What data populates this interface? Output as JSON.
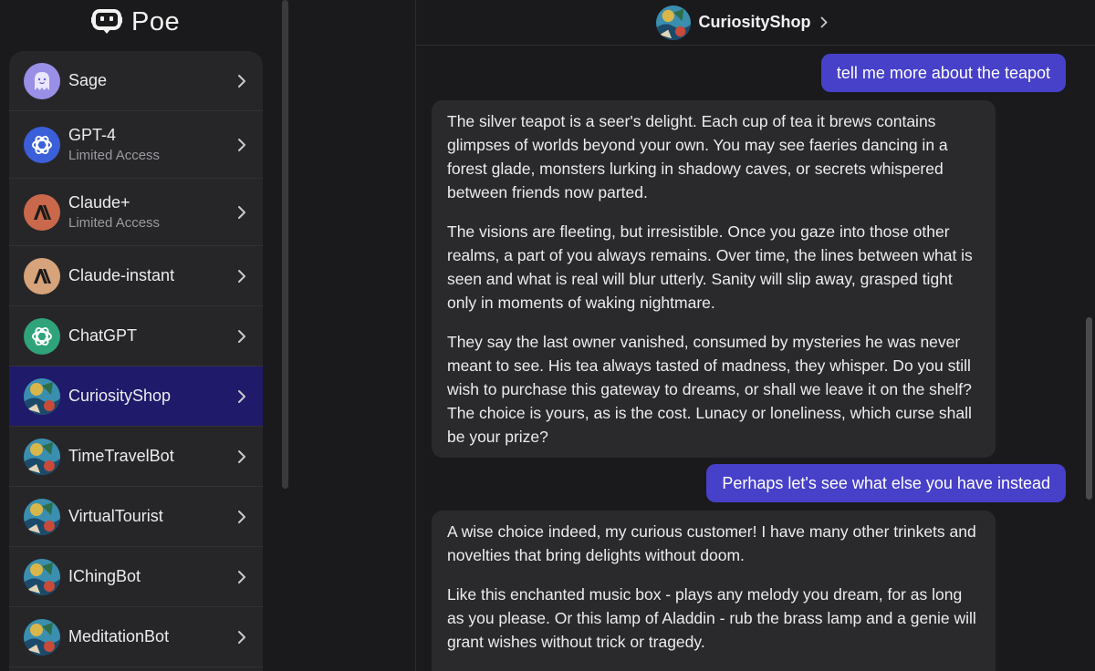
{
  "app": {
    "logo_text": "Poe"
  },
  "sidebar": {
    "bots": [
      {
        "name": "Sage",
        "sub": "",
        "avatar": "sage",
        "active": false
      },
      {
        "name": "GPT-4",
        "sub": "Limited Access",
        "avatar": "openai-blue",
        "active": false
      },
      {
        "name": "Claude+",
        "sub": "Limited Access",
        "avatar": "anthropic-orange",
        "active": false
      },
      {
        "name": "Claude-instant",
        "sub": "",
        "avatar": "anthropic-tan",
        "active": false
      },
      {
        "name": "ChatGPT",
        "sub": "",
        "avatar": "openai-green",
        "active": false
      },
      {
        "name": "CuriosityShop",
        "sub": "",
        "avatar": "art",
        "active": true
      },
      {
        "name": "TimeTravelBot",
        "sub": "",
        "avatar": "art",
        "active": false
      },
      {
        "name": "VirtualTourist",
        "sub": "",
        "avatar": "art",
        "active": false
      },
      {
        "name": "IChingBot",
        "sub": "",
        "avatar": "art",
        "active": false
      },
      {
        "name": "MeditationBot",
        "sub": "",
        "avatar": "art",
        "active": false
      }
    ]
  },
  "chat": {
    "title": "CuriosityShop",
    "messages": [
      {
        "role": "user",
        "text": "tell me more about the teapot"
      },
      {
        "role": "bot",
        "paragraphs": [
          "The silver teapot is a seer's delight. Each cup of tea it brews contains glimpses of worlds beyond your own. You may see faeries dancing in a forest glade, monsters lurking in shadowy caves, or secrets whispered between friends now parted.",
          "The visions are fleeting, but irresistible. Once you gaze into those other realms, a part of you always remains. Over time, the lines between what is seen and what is real will blur utterly. Sanity will slip away, grasped tight only in moments of waking nightmare.",
          "They say the last owner vanished, consumed by mysteries he was never meant to see. His tea always tasted of madness, they whisper. Do you still wish to purchase this gateway to dreams, or shall we leave it on the shelf? The choice is yours, as is the cost. Lunacy or loneliness, which curse shall be your prize?"
        ]
      },
      {
        "role": "user",
        "text": "Perhaps let's see what else you have instead"
      },
      {
        "role": "bot",
        "paragraphs": [
          "A wise choice indeed, my curious customer! I have many other trinkets and novelties that bring delights without doom.",
          "Like this enchanted music box - plays any melody you dream, for as long as you please. Or this lamp of Aladdin - rub the brass lamp and a genie will grant wishes without trick or tragedy."
        ]
      }
    ]
  },
  "colors": {
    "accent": "#4740c9",
    "active_item": "#1f1a6a",
    "bubble_bot": "#2a2a2d",
    "background": "#1a1a1c"
  }
}
